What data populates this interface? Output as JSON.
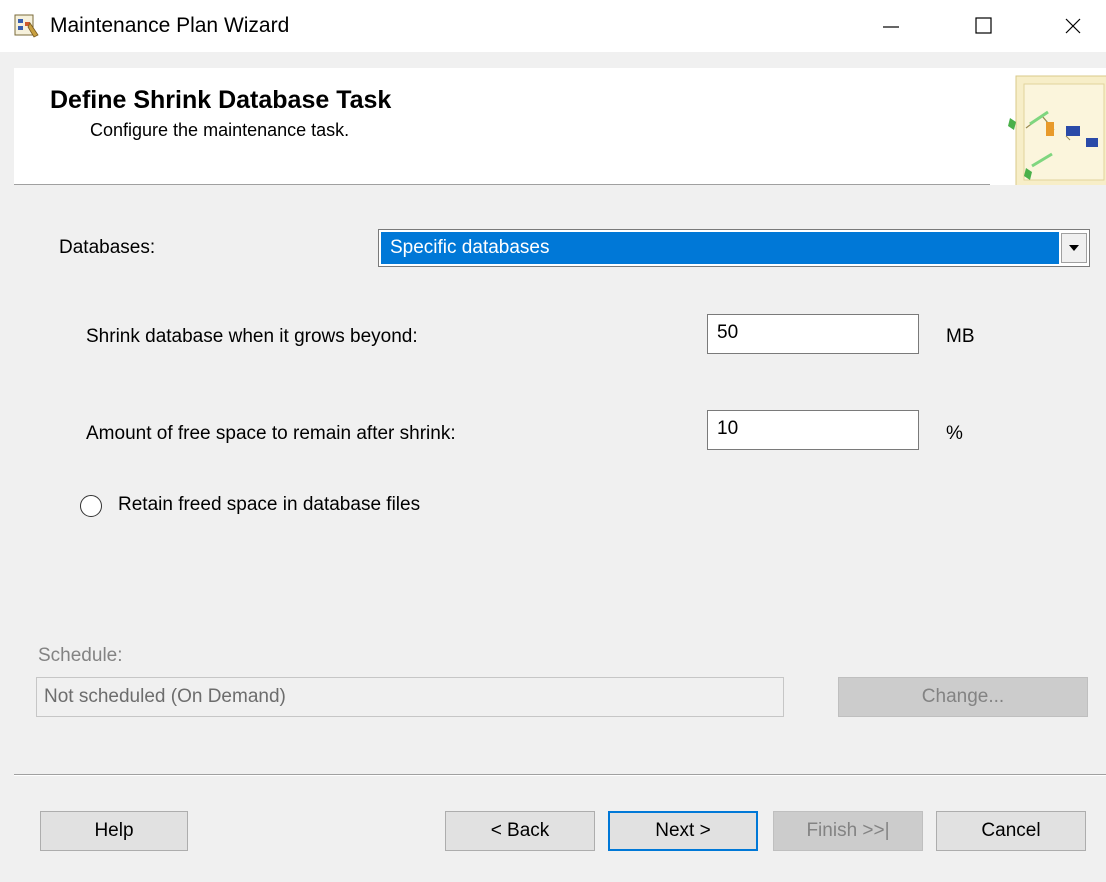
{
  "window": {
    "title": "Maintenance Plan Wizard",
    "icons": {
      "app": "wizard-icon",
      "minimize": "minimize-icon",
      "maximize": "maximize-icon",
      "close": "close-icon"
    }
  },
  "header": {
    "title": "Define Shrink Database Task",
    "subtitle": "Configure the maintenance task.",
    "graphic": "maintenance-plan-graphic"
  },
  "form": {
    "databases_label": "Databases:",
    "databases_value": "Specific databases",
    "shrink_label": "Shrink database when it grows beyond:",
    "shrink_value": "50",
    "shrink_unit": "MB",
    "free_space_label": "Amount of free space to remain after shrink:",
    "free_space_value": "10",
    "free_space_unit": "%",
    "retain_label": "Retain freed space in database files"
  },
  "schedule": {
    "label": "Schedule:",
    "value": "Not scheduled (On Demand)",
    "change_label": "Change..."
  },
  "buttons": {
    "help": "Help",
    "back": "< Back",
    "next": "Next >",
    "finish": "Finish >>|",
    "cancel": "Cancel"
  },
  "colors": {
    "selection": "#0078d7",
    "window_bg": "#f0f0f0",
    "disabled_text": "#838383"
  }
}
